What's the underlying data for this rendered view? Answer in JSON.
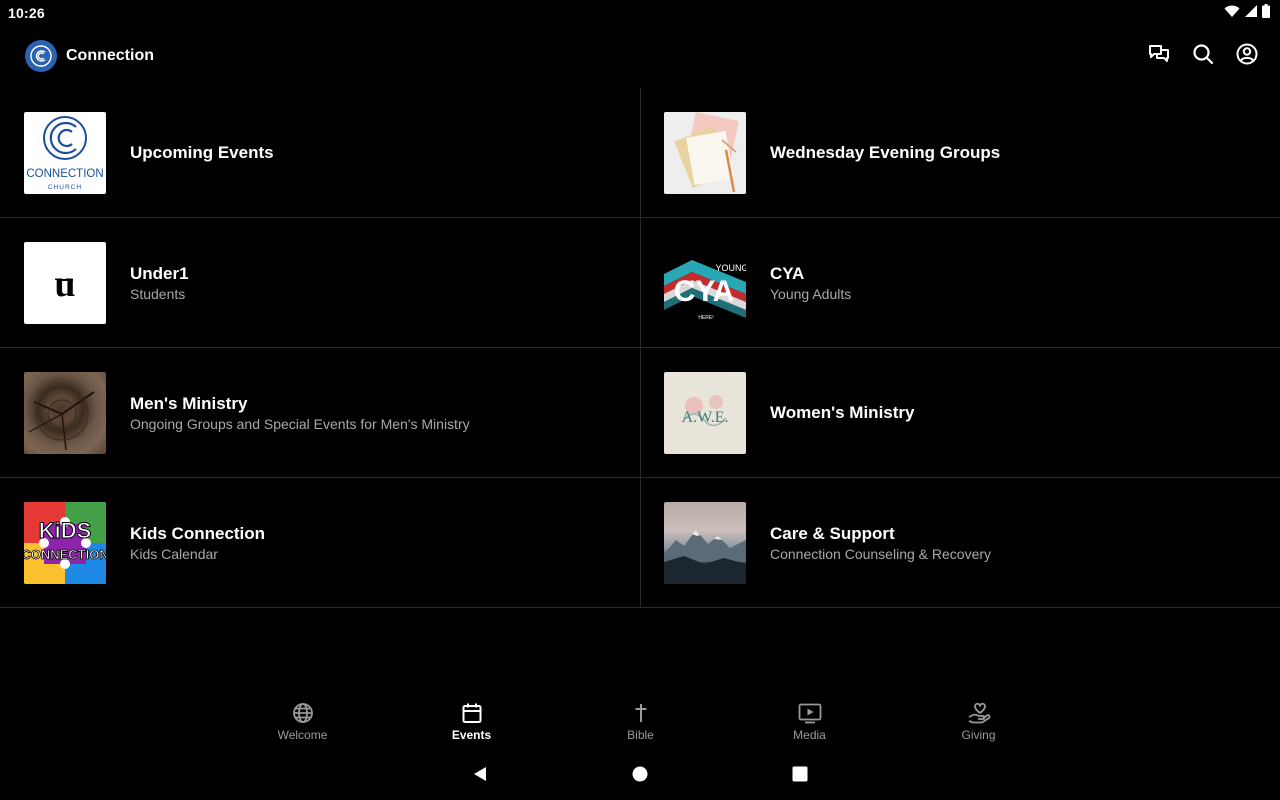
{
  "status": {
    "time": "10:26"
  },
  "app": {
    "title": "Connection"
  },
  "events": [
    {
      "title": "Upcoming Events",
      "subtitle": "",
      "thumb": "connection-church-logo",
      "thumb_text": "CONNECTION",
      "thumb_text2": "CHURCH"
    },
    {
      "title": "Wednesday Evening Groups",
      "subtitle": "",
      "thumb": "notebook-pencil-photo"
    },
    {
      "title": "Under1",
      "subtitle": "Students",
      "thumb": "under1-logo",
      "thumb_text": "u"
    },
    {
      "title": "CYA",
      "subtitle": "Young Adults",
      "thumb": "cya-logo",
      "thumb_text": "CYA",
      "thumb_text2": "YOUNG",
      "thumb_text3": "HERE!"
    },
    {
      "title": "Men's Ministry",
      "subtitle": "Ongoing Groups and Special Events for Men's Ministry",
      "thumb": "wood-texture-photo"
    },
    {
      "title": "Women's Ministry",
      "subtitle": "",
      "thumb": "awe-logo",
      "thumb_text": "A.W.E."
    },
    {
      "title": "Kids Connection",
      "subtitle": "Kids Calendar",
      "thumb": "kids-connection-logo",
      "thumb_text": "KiDS",
      "thumb_text2": "CONNECTION"
    },
    {
      "title": "Care & Support",
      "subtitle": "Connection Counseling & Recovery",
      "thumb": "mountains-photo"
    }
  ],
  "nav": [
    {
      "label": "Welcome",
      "icon": "globe-icon",
      "active": false
    },
    {
      "label": "Events",
      "icon": "calendar-icon",
      "active": true
    },
    {
      "label": "Bible",
      "icon": "cross-icon",
      "active": false
    },
    {
      "label": "Media",
      "icon": "play-screen-icon",
      "active": false
    },
    {
      "label": "Giving",
      "icon": "heart-hand-icon",
      "active": false
    }
  ],
  "colors": {
    "background": "#000000",
    "brand": "#2c63b0",
    "divider": "#2a2a2a",
    "subtitle": "#a8a8a8",
    "nav_inactive": "#9a9a9a"
  }
}
